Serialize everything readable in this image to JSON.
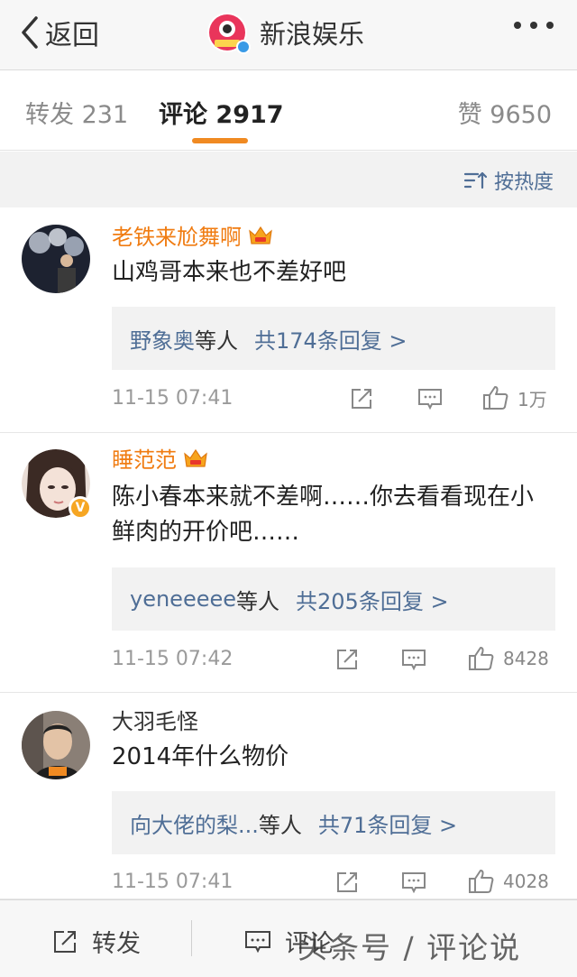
{
  "nav": {
    "back_label": "返回",
    "title": "新浪娱乐"
  },
  "tabs": {
    "repost": {
      "label": "转发",
      "count": "231"
    },
    "comment": {
      "label": "评论",
      "count": "2917"
    },
    "like": {
      "label": "赞",
      "count": "9650"
    }
  },
  "sort": {
    "label": "按热度"
  },
  "comments": [
    {
      "user": "老铁来尬舞啊",
      "text": "山鸡哥本来也不差好吧",
      "reply_names": "野象奥",
      "reply_etc": "等人",
      "reply_total": "共174条回复 >",
      "time": "11-15 07:41",
      "likes": "1万"
    },
    {
      "user": "睡范范",
      "verified_mark": "V",
      "text": "陈小春本来就不差啊……你去看看现在小鲜肉的开价吧……",
      "reply_names": "yeneeeee",
      "reply_etc": "等人",
      "reply_total": "共205条回复 >",
      "time": "11-15 07:42",
      "likes": "8428"
    },
    {
      "user": "大羽毛怪",
      "text": "2014年什么物价",
      "reply_names": "向大佬的梨...",
      "reply_etc": "等人",
      "reply_total": "共71条回复 >",
      "time": "11-15 07:41",
      "likes": "4028"
    }
  ],
  "bottom": {
    "repost_label": "转发",
    "comment_label": "评论",
    "watermark": "头条号 / 评论说"
  },
  "colors": {
    "accent_orange": "#f08a22",
    "link_blue": "#4f6e96",
    "vip_name": "#f07c12"
  }
}
